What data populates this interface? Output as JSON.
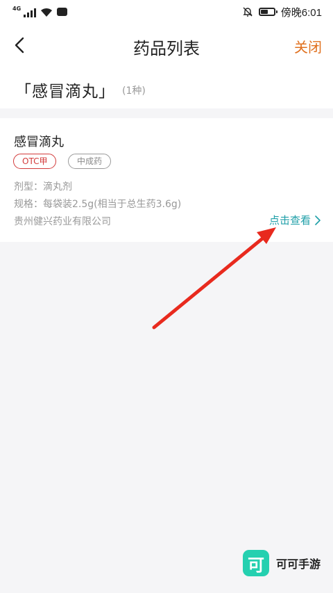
{
  "status_bar": {
    "signal_label": "4G",
    "time": "傍晚6:01",
    "battery_level": 0.55,
    "icons": [
      "signal-icon",
      "wifi-icon",
      "app-notification-icon",
      "bell-off-icon",
      "battery-icon"
    ]
  },
  "header": {
    "title": "药品列表",
    "close_label": "关闭",
    "back_icon": "chevron-left-icon"
  },
  "drug_heading": {
    "name": "「感冒滴丸」",
    "count": "(1种)"
  },
  "card": {
    "name": "感冒滴丸",
    "tags": [
      "OTC甲",
      "中成药"
    ],
    "dosage_form": "剂型：滴丸剂",
    "spec": "规格：每袋装2.5g(相当于总生药3.6g)",
    "manufacturer": "贵州健兴药业有限公司",
    "view_label": "点击查看"
  },
  "watermark": {
    "logo_char": "可",
    "text": "可可手游"
  },
  "colors": {
    "accent_orange": "#e0701e",
    "link_teal": "#1f9fa8",
    "otc_red": "#d23a3a",
    "annotation_arrow": "#e82a1e",
    "watermark_green": "#25d0b0"
  }
}
